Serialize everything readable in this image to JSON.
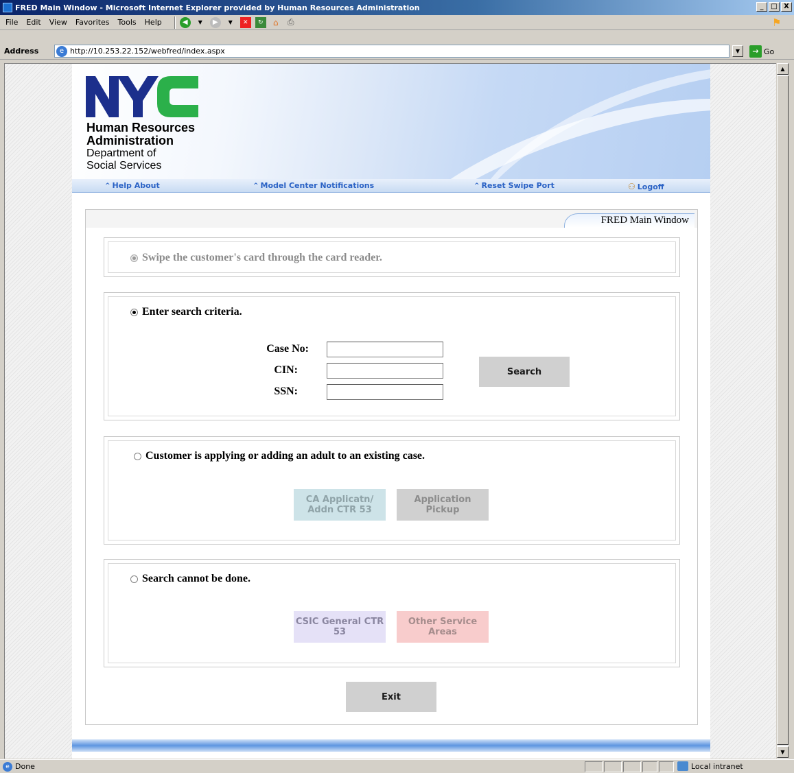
{
  "window": {
    "title": "FRED Main Window - Microsoft Internet Explorer provided by Human Resources Administration",
    "controls": [
      "_",
      "□",
      "X"
    ]
  },
  "menubar": {
    "items": [
      "File",
      "Edit",
      "View",
      "Favorites",
      "Tools",
      "Help"
    ],
    "toolbar_icons": [
      "back-icon",
      "forward-icon",
      "stop-icon",
      "refresh-icon",
      "home-icon",
      "print-icon"
    ]
  },
  "address": {
    "label": "Address",
    "url": "http://10.253.22.152/webfred/index.aspx",
    "go_label": "Go"
  },
  "header": {
    "logo_lines": [
      "Human Resources",
      "Administration",
      "Department of",
      "Social Services"
    ],
    "nav": {
      "help_about": "Help About",
      "notifications": "Model Center Notifications",
      "reset_swipe": "Reset Swipe Port",
      "logoff": "Logoff"
    }
  },
  "main": {
    "tab_label": "FRED Main Window",
    "swipe": {
      "label": "Swipe the customer's card through the card reader."
    },
    "search": {
      "label": "Enter search criteria.",
      "case_no_label": "Case No:",
      "cin_label": "CIN:",
      "ssn_label": "SSN:",
      "case_no_value": "",
      "cin_value": "",
      "ssn_value": "",
      "search_button": "Search"
    },
    "applying": {
      "label": "Customer is applying or adding an adult to an existing case.",
      "ca_button_line1": "CA Applicatn/",
      "ca_button_line2": "Addn CTR 53",
      "pickup_button": "Application Pickup"
    },
    "no_search": {
      "label": "Search cannot be done.",
      "csic_line1": "CSIC General CTR",
      "csic_line2": "53",
      "other_line1": "Other Service",
      "other_line2": "Areas"
    },
    "exit_button": "Exit"
  },
  "status": {
    "text": "Done",
    "zone": "Local intranet"
  },
  "colors": {
    "nyc_blue": "#1c2f8c",
    "nyc_green": "#2bb04a",
    "link_blue": "#2a62c5"
  }
}
